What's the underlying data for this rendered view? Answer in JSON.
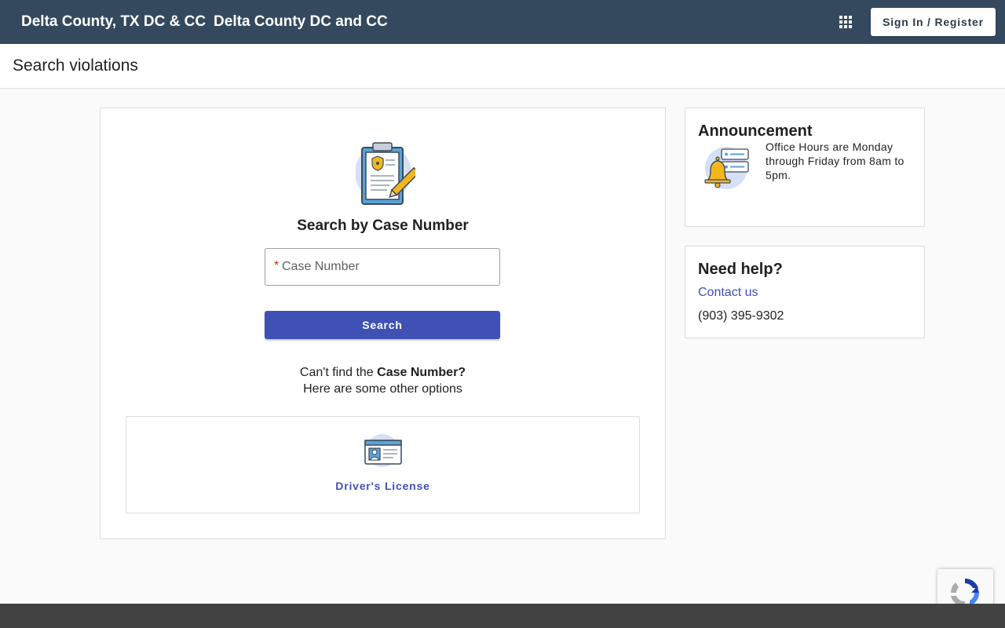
{
  "header": {
    "brand": "Delta County, TX DC & CC",
    "court_name": "Delta County DC and CC",
    "apps_icon": "grid-apps-icon",
    "signin_label": "Sign In / Register"
  },
  "page": {
    "title": "Search violations"
  },
  "search": {
    "icon": "clipboard-badge-icon",
    "title": "Search by Case Number",
    "required_marker": "*",
    "input_placeholder": "Case Number",
    "input_value": "",
    "button_label": "Search",
    "cant_find_prefix": "Can't find the",
    "cant_find_bold": "Case Number?",
    "other_options": "Here are some other options"
  },
  "options": [
    {
      "icon": "drivers-license-icon",
      "label": "Driver's License"
    }
  ],
  "announcement": {
    "title": "Announcement",
    "icon": "bell-notification-icon",
    "text": "Office Hours are Monday through Friday from 8am to 5pm."
  },
  "help": {
    "title": "Need help?",
    "contact_label": "Contact us",
    "phone": "(903) 395-9302"
  },
  "colors": {
    "header_bg": "#34495e",
    "primary": "#3f51b5",
    "required": "#c62828",
    "footer_bg": "#424242"
  }
}
